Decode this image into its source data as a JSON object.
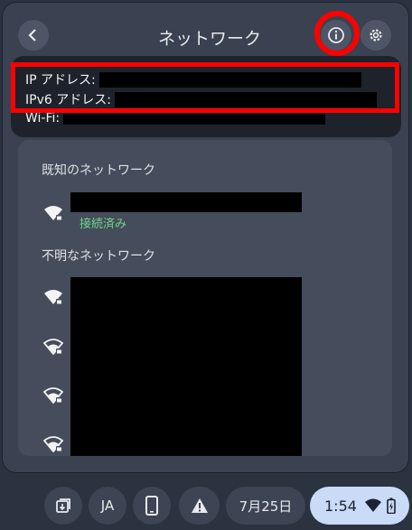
{
  "header": {
    "title": "ネットワーク"
  },
  "info": {
    "ip_label": "IP アドレス:",
    "ipv6_label": "IPv6 アドレス:",
    "wifi_label": "Wi-Fi:"
  },
  "known": {
    "heading": "既知のネットワーク",
    "status": "接続済み"
  },
  "unknown": {
    "heading": "不明なネットワーク"
  },
  "shelf": {
    "ime": "JA",
    "date": "7月25日",
    "time": "1:54"
  },
  "colors": {
    "annotation": "#ff0000",
    "connected": "#6fd68b",
    "panel": "#3a4150"
  },
  "icons": [
    "back-icon",
    "info-icon",
    "gear-icon",
    "wifi-lock-icon",
    "download-icon",
    "phone-icon",
    "warning-icon",
    "battery-icon"
  ]
}
